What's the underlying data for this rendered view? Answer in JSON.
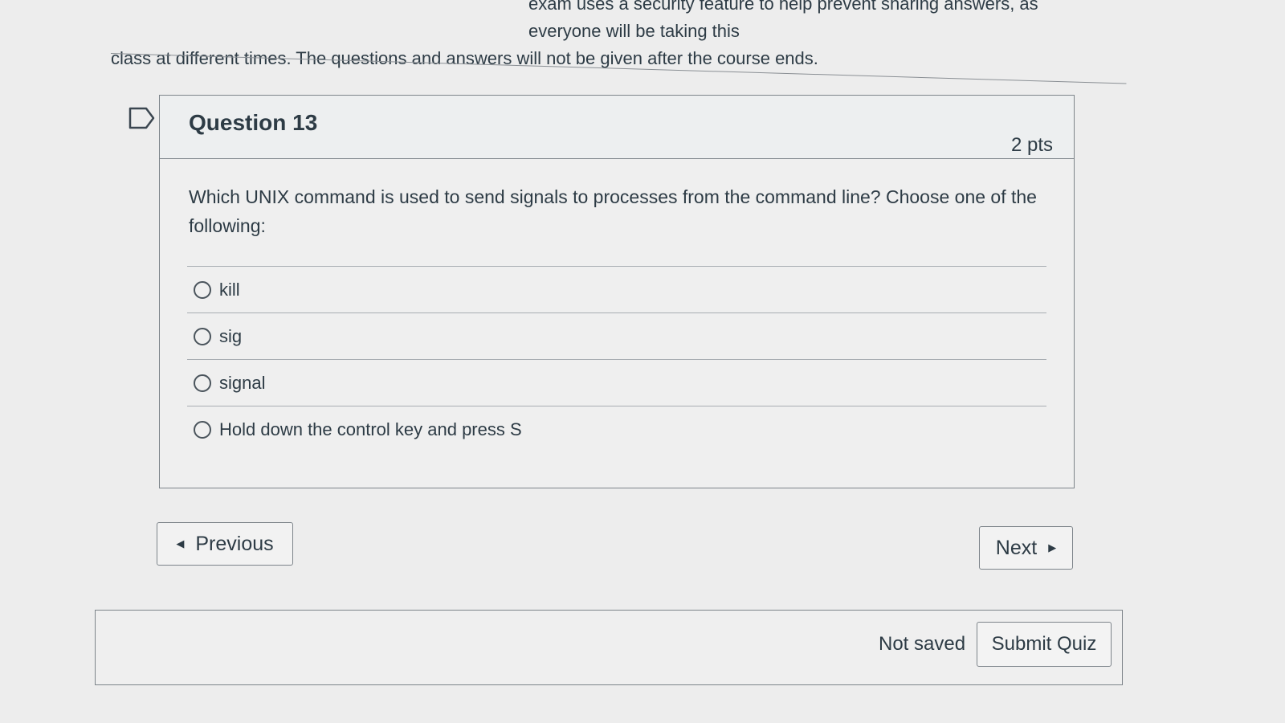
{
  "intro": {
    "line1": "exam uses a security feature to help prevent sharing answers, as everyone will be taking this",
    "line2": "class at different times. The questions and answers will not be given after the course ends."
  },
  "question": {
    "title": "Question 13",
    "points": "2 pts",
    "text": "Which UNIX command is used to send signals to processes from the command line? Choose one of the following:",
    "answers": [
      {
        "label": "kill"
      },
      {
        "label": "sig"
      },
      {
        "label": "signal"
      },
      {
        "label": "Hold down the control key and press S"
      }
    ]
  },
  "navigation": {
    "previous_label": "Previous",
    "next_label": "Next"
  },
  "footer": {
    "status": "Not saved",
    "submit_label": "Submit Quiz"
  },
  "icons": {
    "flag": "flag-icon",
    "previous": "triangle-left-icon",
    "next": "triangle-right-icon"
  }
}
